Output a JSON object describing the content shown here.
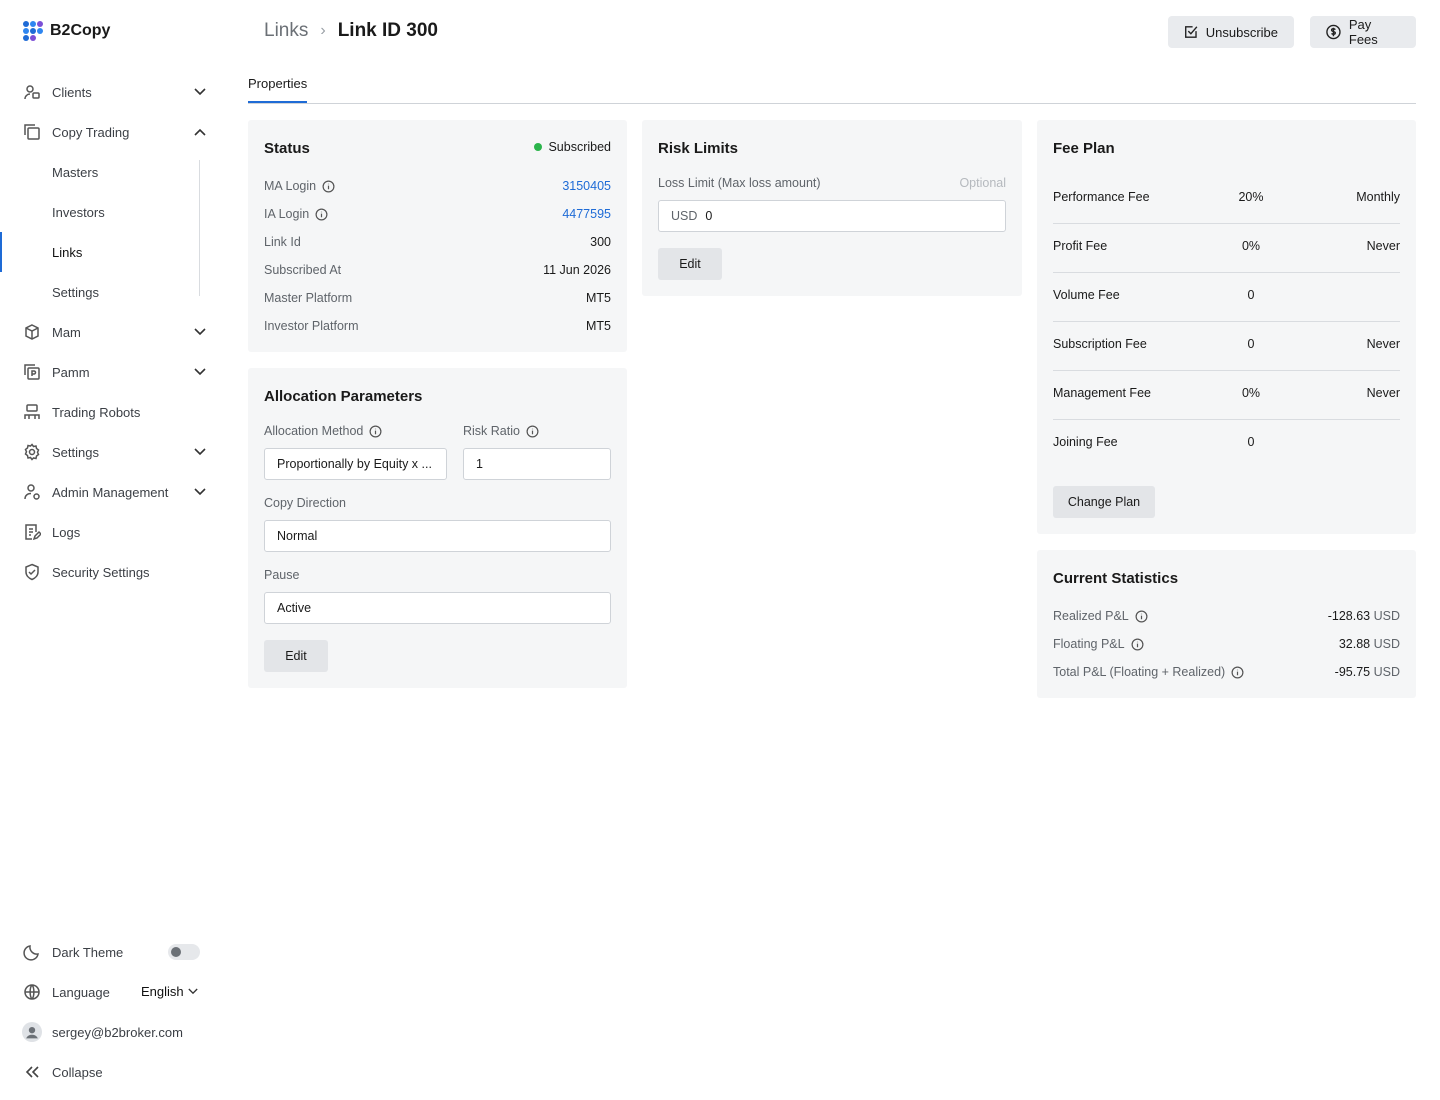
{
  "app": {
    "name": "B2Copy"
  },
  "sidebar": {
    "items": [
      {
        "label": "Clients",
        "icon": "clients-icon"
      },
      {
        "label": "Copy Trading",
        "icon": "copy-trading-icon"
      },
      {
        "label": "Mam",
        "icon": "mam-icon"
      },
      {
        "label": "Pamm",
        "icon": "pamm-icon"
      },
      {
        "label": "Trading Robots",
        "icon": "trading-robots-icon"
      },
      {
        "label": "Settings",
        "icon": "gear-icon"
      },
      {
        "label": "Admin Management",
        "icon": "admin-icon"
      },
      {
        "label": "Logs",
        "icon": "logs-icon"
      },
      {
        "label": "Security Settings",
        "icon": "shield-icon"
      }
    ],
    "copy_trading_sub": [
      {
        "label": "Masters"
      },
      {
        "label": "Investors"
      },
      {
        "label": "Links",
        "active": true
      },
      {
        "label": "Settings"
      }
    ],
    "footer": {
      "dark_theme": "Dark Theme",
      "language_label": "Language",
      "language_value": "English",
      "user_email": "sergey@b2broker.com",
      "collapse": "Collapse"
    }
  },
  "header": {
    "breadcrumb_parent": "Links",
    "breadcrumb_current": "Link ID 300",
    "unsubscribe": "Unsubscribe",
    "pay_fees": "Pay Fees"
  },
  "tabs": [
    {
      "label": "Properties",
      "active": true
    }
  ],
  "status_card": {
    "title": "Status",
    "status": "Subscribed",
    "rows": [
      {
        "label": "MA Login",
        "value": "3150405"
      },
      {
        "label": "IA Login",
        "value": "4477595"
      },
      {
        "label": "Link Id",
        "value": "300"
      },
      {
        "label": "Subscribed At",
        "value": "11 Jun 2026"
      },
      {
        "label": "Master Platform",
        "value": "MT5"
      },
      {
        "label": "Investor Platform",
        "value": "MT5"
      }
    ]
  },
  "allocation_card": {
    "title": "Allocation Parameters",
    "method_label": "Allocation Method",
    "method_value": "Proportionally by Equity x ...",
    "ratio_label": "Risk Ratio",
    "ratio_value": "1",
    "direction_label": "Copy Direction",
    "direction_value": "Normal",
    "pause_label": "Pause",
    "pause_value": "Active",
    "edit": "Edit"
  },
  "risk_card": {
    "title": "Risk Limits",
    "loss_label": "Loss Limit (Max loss amount)",
    "optional": "Optional",
    "currency": "USD",
    "loss_value": "0",
    "edit": "Edit"
  },
  "fee_card": {
    "title": "Fee Plan",
    "rows": [
      {
        "name": "Performance Fee",
        "amount": "20%",
        "period": "Monthly"
      },
      {
        "name": "Profit Fee",
        "amount": "0%",
        "period": "Never"
      },
      {
        "name": "Volume Fee",
        "amount": "0",
        "period": ""
      },
      {
        "name": "Subscription Fee",
        "amount": "0",
        "period": "Never"
      },
      {
        "name": "Management Fee",
        "amount": "0%",
        "period": "Never"
      },
      {
        "name": "Joining Fee",
        "amount": "0",
        "period": ""
      }
    ],
    "change_plan": "Change Plan"
  },
  "stats_card": {
    "title": "Current Statistics",
    "rows": [
      {
        "label": "Realized P&L",
        "value": "-128.63",
        "unit": "USD"
      },
      {
        "label": "Floating P&L",
        "value": "32.88",
        "unit": "USD"
      },
      {
        "label": "Total P&L (Floating + Realized)",
        "value": "-95.75",
        "unit": "USD"
      }
    ]
  },
  "colors": {
    "accent": "#1e6bd6",
    "status_ok": "#2bb44b",
    "card_bg": "#f5f6f7"
  }
}
